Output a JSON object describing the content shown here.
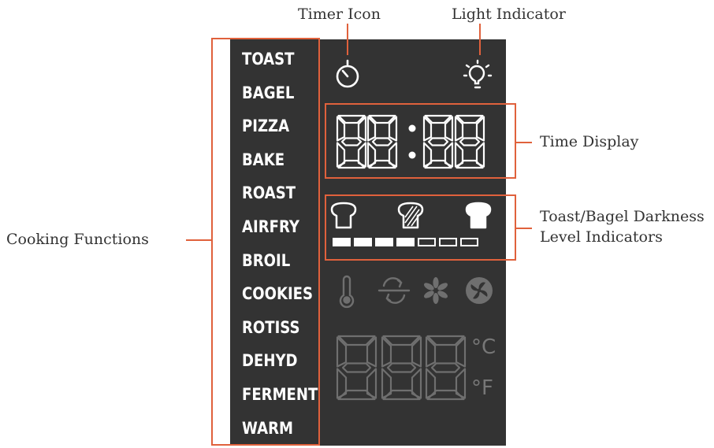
{
  "callouts": {
    "timer_icon": "Timer Icon",
    "light_indicator": "Light Indicator",
    "time_display": "Time Display",
    "darkness_line1": "Toast/Bagel Darkness",
    "darkness_line2": "Level Indicators",
    "cooking_functions": "Cooking Functions"
  },
  "functions": [
    "TOAST",
    "BAGEL",
    "PIZZA",
    "BAKE",
    "ROAST",
    "AIRFRY",
    "BROIL",
    "COOKIES",
    "ROTISS",
    "DEHYD",
    "FERMENT",
    "WARM"
  ],
  "time_display": "88:88",
  "temperature_display": "888",
  "units": {
    "celsius": "°C",
    "fahrenheit": "°F"
  },
  "darkness": {
    "segments": 7,
    "filled": 4
  },
  "colors": {
    "accent": "#e0613c",
    "panel": "#333333",
    "lit": "#ffffff",
    "unlit": "#6f6f6f"
  },
  "icons": [
    "timer-icon",
    "light-bulb-icon",
    "toast-light-icon",
    "toast-medium-icon",
    "toast-dark-icon",
    "thermometer-icon",
    "rotisserie-icon",
    "fan-icon",
    "convection-fan-icon"
  ]
}
